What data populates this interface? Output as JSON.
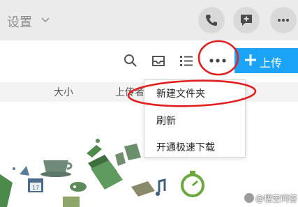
{
  "header": {
    "title": "设置",
    "buttons": [
      {
        "name": "phone-icon"
      },
      {
        "name": "add-message-icon"
      },
      {
        "name": "more-horizontal-icon"
      }
    ]
  },
  "toolbar": {
    "icons": [
      "search-icon",
      "inbox-icon",
      "list-view-icon",
      "more-horizontal-icon"
    ],
    "upload_label": "上传",
    "accent_color": "#1aa3f7"
  },
  "columns": {
    "size": "大小",
    "uploader": "上传者"
  },
  "context_menu": {
    "items": [
      {
        "label": "新建文件夹"
      },
      {
        "label": "刷新"
      },
      {
        "label": "开通极速下载"
      }
    ]
  },
  "annotation_color": "#e02020",
  "watermark": {
    "text": "@悟空问答"
  }
}
